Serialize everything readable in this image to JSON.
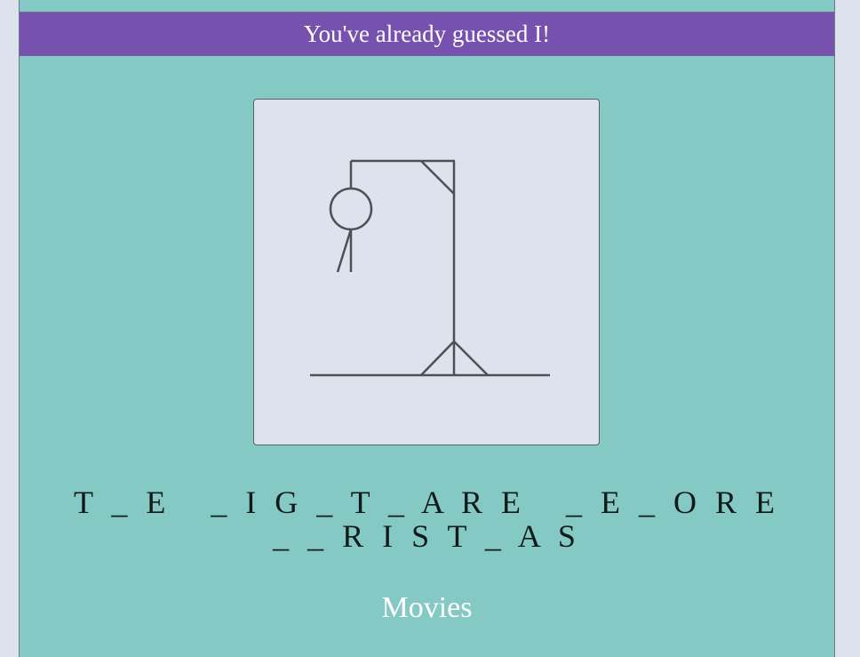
{
  "message": "You've already guessed I!",
  "puzzle": {
    "line1": "T_E _IG_T_ARE _E_ORE",
    "line2": "__RIST_AS"
  },
  "category": "Movies",
  "colors": {
    "page_background": "#dde3ec",
    "panel_background": "#84c9c4",
    "message_bar": "#7652ae",
    "drawing_box": "#dde3ec",
    "stroke": "#4e5058"
  },
  "hangman": {
    "drawn_parts": [
      "head",
      "body",
      "left-arm"
    ]
  }
}
